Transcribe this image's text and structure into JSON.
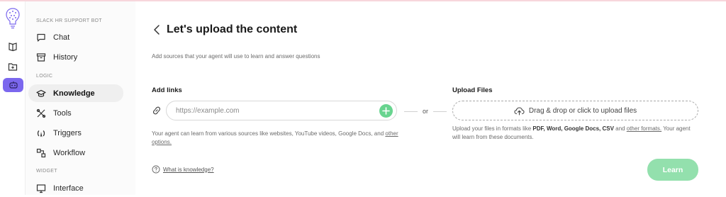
{
  "colors": {
    "accent": "#7b67ee",
    "success": "#68d48f",
    "learn_button": "#93e0ad"
  },
  "rail": {
    "items": [
      {
        "icon": "book-icon"
      },
      {
        "icon": "folder-plus-icon"
      },
      {
        "icon": "bot-icon",
        "active": true
      }
    ]
  },
  "sidebar": {
    "section_bot": "SLACK HR SUPPORT BOT",
    "section_logic": "LOGIC",
    "section_widget": "WIDGET",
    "items": [
      {
        "label": "Chat",
        "icon": "chat-icon"
      },
      {
        "label": "History",
        "icon": "archive-icon"
      },
      {
        "label": "Knowledge",
        "icon": "graduation-cap-icon",
        "active": true
      },
      {
        "label": "Tools",
        "icon": "tools-icon"
      },
      {
        "label": "Triggers",
        "icon": "trigger-icon"
      },
      {
        "label": "Workflow",
        "icon": "workflow-icon"
      },
      {
        "label": "Interface",
        "icon": "monitor-icon"
      }
    ]
  },
  "main": {
    "title": "Let's upload the content",
    "subtitle": "Add sources that your agent will use to learn and answer questions",
    "links": {
      "heading": "Add links",
      "placeholder": "https://example.com",
      "help_text": "Your agent can learn from various sources like websites, YouTube videos, Google Docs, and",
      "help_link": "other options."
    },
    "or_label": "or",
    "files": {
      "heading": "Upload Files",
      "drop_label": "Drag & drop or click to upload files",
      "help_prefix": "Upload your files in formats like",
      "formats": "PDF, Word, Google Docs, CSV",
      "help_and": "and",
      "help_link": "other formats.",
      "help_suffix": "Your agent will learn from these documents."
    },
    "what_is_knowledge": "What is knowledge?",
    "learn_button": "Learn"
  }
}
